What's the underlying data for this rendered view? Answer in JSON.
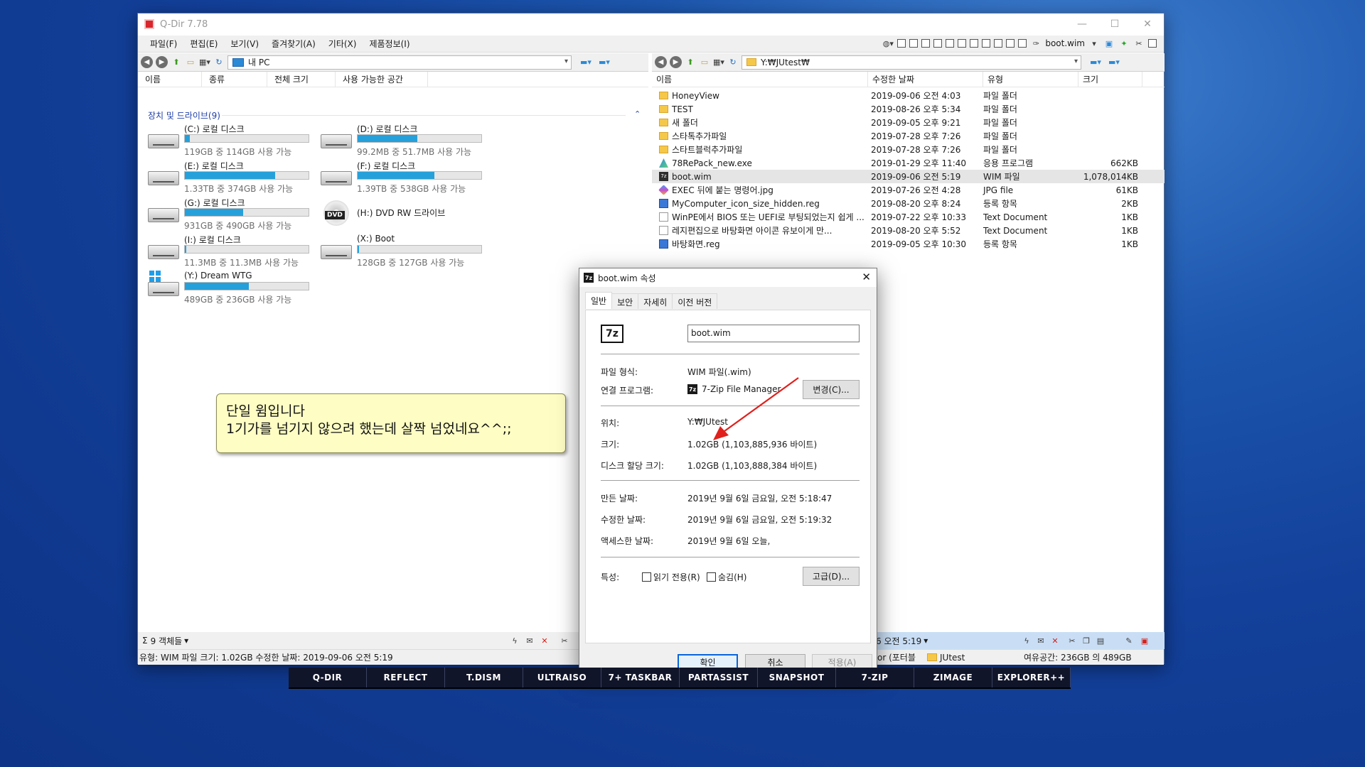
{
  "window": {
    "title": "Q-Dir 7.78",
    "caption_buttons": [
      "—",
      "☐",
      "✕"
    ]
  },
  "menubar": {
    "items": [
      "파일(F)",
      "편집(E)",
      "보기(V)",
      "즐겨찾기(A)",
      "기타(X)",
      "제품정보(I)"
    ],
    "right_label": "boot.wim"
  },
  "left_pane": {
    "address": "내 PC",
    "columns": [
      "이름",
      "종류",
      "전체 크기",
      "사용 가능한 공간"
    ],
    "group_title": "장치 및 드라이브(9)",
    "drives": [
      {
        "name": "(C:) 로컬 디스크",
        "sub": "119GB 중 114GB 사용 가능",
        "used_fraction": 0.04
      },
      {
        "name": "(D:) 로컬 디스크",
        "sub": "99.2MB 중 51.7MB 사용 가능",
        "used_fraction": 0.48
      },
      {
        "name": "(E:) 로컬 디스크",
        "sub": "1.33TB 중 374GB 사용 가능",
        "used_fraction": 0.73
      },
      {
        "name": "(F:) 로컬 디스크",
        "sub": "1.39TB 중 538GB 사용 가능",
        "used_fraction": 0.62
      },
      {
        "name": "(G:) 로컬 디스크",
        "sub": "931GB 중 490GB 사용 가능",
        "used_fraction": 0.47
      },
      {
        "name": "(H:) DVD RW 드라이브",
        "sub": "",
        "used_fraction": null
      },
      {
        "name": "(I:) 로컬 디스크",
        "sub": "11.3MB 중 11.3MB 사용 가능",
        "used_fraction": 0.01
      },
      {
        "name": "(X:) Boot",
        "sub": "128GB 중 127GB 사용 가능",
        "used_fraction": 0.01
      },
      {
        "name": "(Y:) Dream WTG",
        "sub": "489GB 중 236GB 사용 가능",
        "used_fraction": 0.52
      }
    ],
    "dvd_tag": "DVD",
    "status_count": "9 객체들",
    "status_sigma": "Σ"
  },
  "right_pane": {
    "address": "Y:₩JUtest₩",
    "columns": [
      "이름",
      "수정한 날짜",
      "유형",
      "크기"
    ],
    "files": [
      {
        "icon": "folder",
        "name": "HoneyView",
        "date": "2019-09-06 오전 4:03",
        "type": "파일 폴더",
        "size": ""
      },
      {
        "icon": "folder",
        "name": "TEST",
        "date": "2019-08-26 오후 5:34",
        "type": "파일 폴더",
        "size": ""
      },
      {
        "icon": "folder",
        "name": "새 폴더",
        "date": "2019-09-05 오후 9:21",
        "type": "파일 폴더",
        "size": ""
      },
      {
        "icon": "folder",
        "name": "스타톡추가파일",
        "date": "2019-07-28 오후 7:26",
        "type": "파일 폴더",
        "size": ""
      },
      {
        "icon": "folder",
        "name": "스타트블럭추가파일",
        "date": "2019-07-28 오후 7:26",
        "type": "파일 폴더",
        "size": ""
      },
      {
        "icon": "exe",
        "name": "78RePack_new.exe",
        "date": "2019-01-29 오후 11:40",
        "type": "응용 프로그램",
        "size": "662KB"
      },
      {
        "icon": "wim",
        "name": "boot.wim",
        "date": "2019-09-06 오전 5:19",
        "type": "WIM 파일",
        "size": "1,078,014KB"
      },
      {
        "icon": "jpg",
        "name": "EXEC 뒤에 붙는 명령어.jpg",
        "date": "2019-07-26 오전 4:28",
        "type": "JPG file",
        "size": "61KB"
      },
      {
        "icon": "reg",
        "name": "MyComputer_icon_size_hidden.reg",
        "date": "2019-08-20 오후 8:24",
        "type": "등록 항목",
        "size": "2KB"
      },
      {
        "icon": "txt",
        "name": "WinPE에서 BIOS 또는 UEFI로 부팅되었는지 쉽게 ...",
        "date": "2019-07-22 오후 10:33",
        "type": "Text Document",
        "size": "1KB"
      },
      {
        "icon": "txt",
        "name": "레지편집으로 바탕화면 아이콘 유보이게 만...",
        "date": "2019-08-20 오후 5:52",
        "type": "Text Document",
        "size": "1KB"
      },
      {
        "icon": "reg",
        "name": "바탕화면.reg",
        "date": "2019-09-05 오후 10:30",
        "type": "등록 항목",
        "size": "1KB"
      }
    ],
    "status_date": "6 오전 5:19",
    "status_folder": "JUtest",
    "status_folder_prefix": "or (포터블",
    "free_space": "여유공간: 236GB 의 489GB"
  },
  "bottom_status": "유형: WIM 파일 크기: 1.02GB 수정한 날짜: 2019-09-06 오전 5:19",
  "callout": {
    "line1": "단일 윔입니다",
    "line2": "1기가를 넘기지 않으려 했는데 살짝 넘었네요^^;;"
  },
  "dialog": {
    "title": "boot.wim 속성",
    "icon_text": "7z",
    "tabs": [
      "일반",
      "보안",
      "자세히",
      "이전 버전"
    ],
    "filename": "boot.wim",
    "rows": {
      "file_type_label": "파일 형식:",
      "file_type": "WIM 파일(.wim)",
      "open_with_label": "연결 프로그램:",
      "open_with": "7-Zip File Manager",
      "change_button": "변경(C)...",
      "location_label": "위치:",
      "location": "Y:₩JUtest",
      "size_label": "크기:",
      "size": "1.02GB (1,103,885,936 바이트)",
      "disk_size_label": "디스크 할당 크기:",
      "disk_size": "1.02GB (1,103,888,384 바이트)",
      "created_label": "만든 날짜:",
      "created": "2019년 9월 6일 금요일, 오전 5:18:47",
      "modified_label": "수정한 날짜:",
      "modified": "2019년 9월 6일 금요일, 오전 5:19:32",
      "accessed_label": "액세스한 날짜:",
      "accessed": "2019년 9월 6일 오늘,",
      "attributes_label": "특성:",
      "readonly": "읽기 전용(R)",
      "hidden": "숨김(H)",
      "advanced_button": "고급(D)..."
    },
    "ok": "확인",
    "cancel": "취소",
    "apply": "적용(A)"
  },
  "launcher": [
    "Q-DIR",
    "REFLECT",
    "T.DISM",
    "ULTRAISO",
    "7+ TASKBAR",
    "PARTASSIST",
    "SNAPSHOT",
    "7-ZIP",
    "ZIMAGE",
    "EXPLORER++"
  ],
  "colors": {
    "accent": "#26a0da",
    "selection": "#e5e5e5",
    "callout": "#fdfdc4",
    "arrow": "#e0201c"
  }
}
